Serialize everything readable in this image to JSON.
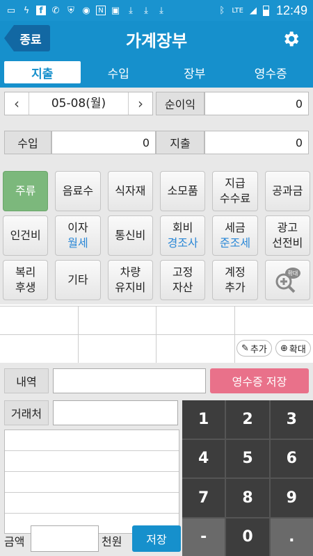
{
  "status_bar": {
    "time": "12:49",
    "network": "LTE",
    "icons": [
      "chat-icon",
      "bolt-icon",
      "facebook-icon",
      "call-icon",
      "vpn-icon",
      "wifi-icon",
      "n-icon",
      "camera-icon",
      "download-icon",
      "download-icon",
      "download-icon",
      "bluetooth-icon",
      "signal-icon",
      "battery-icon"
    ]
  },
  "header": {
    "exit_label": "종료",
    "title": "가계장부",
    "settings_icon": "gear-icon"
  },
  "tabs": [
    {
      "label": "지출",
      "active": true
    },
    {
      "label": "수입",
      "active": false
    },
    {
      "label": "장부",
      "active": false
    },
    {
      "label": "영수증",
      "active": false
    }
  ],
  "summary": {
    "date": "05-08(월)",
    "prev_icon": "chevron-left-icon",
    "next_icon": "chevron-right-icon",
    "net_profit_label": "순이익",
    "net_profit_value": "0",
    "income_label": "수입",
    "income_value": "0",
    "expense_label": "지출",
    "expense_value": "0"
  },
  "categories": [
    {
      "line1": "주류",
      "line2": "",
      "selected": true
    },
    {
      "line1": "음료수",
      "line2": ""
    },
    {
      "line1": "식자재",
      "line2": ""
    },
    {
      "line1": "소모품",
      "line2": ""
    },
    {
      "line1": "지급",
      "line2": "수수료"
    },
    {
      "line1": "공과금",
      "line2": ""
    },
    {
      "line1": "인건비",
      "line2": ""
    },
    {
      "line1": "이자",
      "sub": "월세"
    },
    {
      "line1": "통신비",
      "line2": ""
    },
    {
      "line1": "회비",
      "sub": "경조사"
    },
    {
      "line1": "세금",
      "sub": "준조세"
    },
    {
      "line1": "광고",
      "line2": "선전비"
    },
    {
      "line1": "복리",
      "line2": "후생"
    },
    {
      "line1": "기타",
      "line2": ""
    },
    {
      "line1": "차량",
      "line2": "유지비"
    },
    {
      "line1": "고정",
      "line2": "자산"
    },
    {
      "line1": "계정",
      "line2": "추가"
    },
    {
      "zoom_label": "확대"
    }
  ],
  "table_tools": {
    "add_label": "추가",
    "zoom_label": "확대"
  },
  "form": {
    "memo_label": "내역",
    "memo_value": "",
    "vendor_label": "거래처",
    "vendor_value": "",
    "save_receipt_label": "영수증 저장",
    "amount_label": "금액",
    "amount_value": "",
    "unit_label": "천원",
    "save_label": "저장"
  },
  "keypad": [
    "1",
    "2",
    "3",
    "4",
    "5",
    "6",
    "7",
    "8",
    "9",
    "-",
    "0",
    "."
  ]
}
